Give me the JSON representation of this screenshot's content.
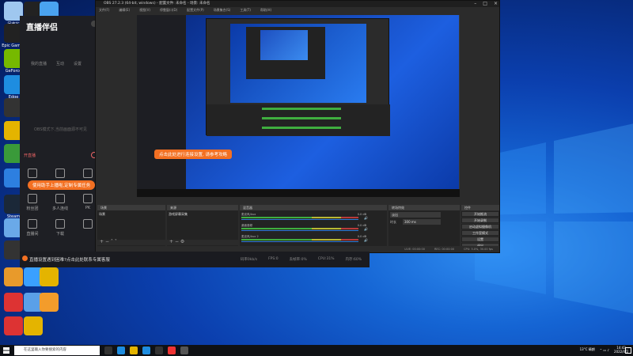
{
  "desktop": {
    "icons": [
      {
        "label": "回收站",
        "icon": "recycle-bin-icon",
        "color": "#9fc7ef"
      },
      {
        "label": "",
        "icon": "monitor-icon",
        "color": "#222"
      },
      {
        "label": "",
        "icon": "mail-icon",
        "color": "#4aa3f0"
      },
      {
        "label": "Epic Games",
        "icon": "epic-icon",
        "color": "#222"
      },
      {
        "label": "",
        "icon": "app-icon",
        "color": "#d33"
      },
      {
        "label": "",
        "icon": "qq-icon",
        "color": "#f39c2b"
      },
      {
        "label": "GeForce",
        "icon": "nvidia-icon",
        "color": "#76b900"
      },
      {
        "label": "Edge",
        "icon": "edge-icon",
        "color": "#1e8de0"
      },
      {
        "label": "",
        "icon": "obs-icon",
        "color": "#333"
      },
      {
        "label": "",
        "icon": "app-icon",
        "color": "#e4b400"
      },
      {
        "label": "",
        "icon": "app-icon",
        "color": "#3a9a3a"
      },
      {
        "label": "",
        "icon": "app-icon",
        "color": "#2d7fe0"
      },
      {
        "label": "Steam",
        "icon": "steam-icon",
        "color": "#1b2838"
      },
      {
        "label": "",
        "icon": "app-icon",
        "color": "#6aa9e8"
      },
      {
        "label": "",
        "icon": "app-icon",
        "color": "#333"
      }
    ]
  },
  "zhibo": {
    "logo": "直播伴侣",
    "tabs": [
      "我的直播",
      "互动",
      "设置"
    ],
    "hint": "OBS模式下,当前画面源不可见",
    "live_label": "开直播",
    "tools": [
      {
        "label": "",
        "icon": "gift-icon"
      },
      {
        "label": "",
        "icon": "user-icon"
      },
      {
        "label": "",
        "icon": "box-icon"
      },
      {
        "label": "粉丝团",
        "icon": "fans-icon"
      },
      {
        "label": "多人连线",
        "icon": "link-icon"
      },
      {
        "label": "PK",
        "icon": "pk-icon"
      },
      {
        "label": "直播间",
        "icon": "room-icon"
      },
      {
        "label": "下载",
        "icon": "download-icon"
      },
      {
        "label": "",
        "icon": "calendar-icon"
      }
    ],
    "banner": "使用助手上播啦,定制专属任务",
    "bottom_msg": "直播设置遇到困难?点击此处联系专属客服",
    "stats": [
      "码率0kb/s",
      "FPS:0",
      "丢帧率:0%",
      "CPU:31%",
      "内存:60%"
    ]
  },
  "obs": {
    "title": "OBS 27.2.3 (64-bit, windows) - 配置文件: 未命名 - 场景: 未命名",
    "menu": [
      "文件(F)",
      "编辑(E)",
      "视图(V)",
      "停靠窗口(D)",
      "配置文件(P)",
      "场景集合(S)",
      "工具(T)",
      "帮助(H)"
    ],
    "docks": {
      "scenes": "场景",
      "sources": "来源",
      "mixer": "混音器",
      "transitions": "转场特效",
      "controls": "控件"
    },
    "scene_item": "场景",
    "source_item": "游戏屏幕采集",
    "mixer_tracks": [
      {
        "name": "麦克风/Aux",
        "db": "0.0 dB"
      },
      {
        "name": "桌面音频",
        "db": "0.0 dB"
      },
      {
        "name": "麦克风/Aux 2",
        "db": "0.0 dB"
      }
    ],
    "transition": {
      "value": "淡出",
      "duration_label": "时长",
      "duration": "300 ms"
    },
    "controls": [
      "开始推流",
      "开始录制",
      "启动虚拟摄像机",
      "工作室模式",
      "设置",
      "退出"
    ],
    "status": [
      "LIVE: 00:00:00",
      "REC: 00:00:00",
      "CPU: 5.0%, 30.00 fps"
    ]
  },
  "overlay_banner": "点击此处进行连接设置, 请参考攻略",
  "taskbar": {
    "search_placeholder": "在这里输入你要搜索的内容",
    "weather": "13°C 晴朗",
    "time": "14:43",
    "date": "2022/4/2"
  },
  "colors": {
    "orange": "#f37022",
    "obs_bg": "#2b2b2b",
    "desktop_blue": "#1565d4"
  }
}
